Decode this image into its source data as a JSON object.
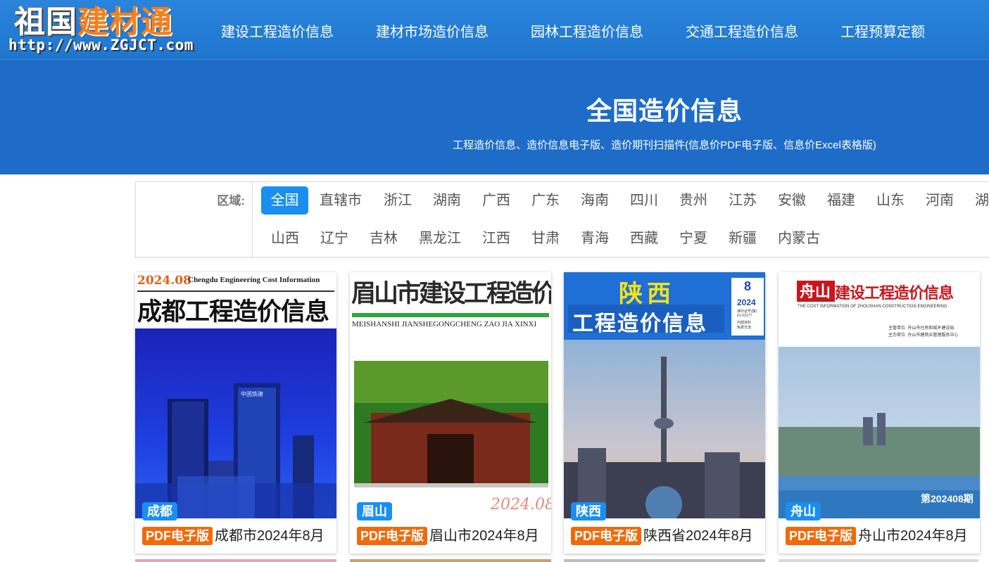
{
  "logo": {
    "name_part1": "祖国",
    "name_part2": "建材通",
    "url": "http://www.ZGJCT.com"
  },
  "nav": [
    {
      "label": "建设工程造价信息"
    },
    {
      "label": "建材市场造价信息"
    },
    {
      "label": "园林工程造价信息"
    },
    {
      "label": "交通工程造价信息"
    },
    {
      "label": "工程预算定额"
    }
  ],
  "banner": {
    "title": "全国造价信息",
    "subtitle": "工程造价信息、造价信息电子版、造价期刊扫描件(信息价PDF电子版、信息价Excel表格版)"
  },
  "filter": {
    "label": "区域:",
    "selected": "全国",
    "regions_row1": [
      "全国",
      "直辖市",
      "浙江",
      "湖南",
      "广西",
      "广东",
      "海南",
      "四川",
      "贵州",
      "江苏",
      "安徽",
      "福建",
      "山东",
      "河南",
      "湖"
    ],
    "regions_row2": [
      "山西",
      "辽宁",
      "吉林",
      "黑龙江",
      "江西",
      "甘肃",
      "青海",
      "西藏",
      "宁夏",
      "新疆",
      "内蒙古"
    ]
  },
  "cards": [
    {
      "tag": "成都",
      "badge": "PDF电子版",
      "title": "成都市2024年8月",
      "cover": {
        "issue": "2024.08",
        "english": "Chengdu Engineering Cost Information",
        "heading": "成都工程造价信息",
        "sign": "中国铁建"
      }
    },
    {
      "tag": "眉山",
      "badge": "PDF电子版",
      "title": "眉山市2024年8月",
      "cover": {
        "heading": "眉山市建设工程造价信息",
        "pinyin": "MEISHANSHI JIANSHEGONGCHENG ZAO JIA XINXI",
        "year": "2024.08"
      }
    },
    {
      "tag": "陕西",
      "badge": "PDF电子版",
      "title": "陕西省2024年8月",
      "cover": {
        "heading1": "陕西",
        "heading2": "工程造价信息",
        "issue_no": "8",
        "year": "2024",
        "note1": "准印证号(陕)",
        "note2": "61-03177",
        "note3": "内部资料",
        "note4": "免费交流"
      }
    },
    {
      "tag": "舟山",
      "badge": "PDF电子版",
      "title": "舟山市2024年8月",
      "cover": {
        "city": "舟山",
        "heading": "建设工程造价信息",
        "english": "THE COST INFORMATION OF ZHOUSHAN CONSTRUCTION ENGINEERING",
        "host_label": "主管单位",
        "host": "舟山市住房和城乡建设局",
        "org_label": "主办单位",
        "org": "舟山市建筑业管理服务中心",
        "issue_prefix": "第",
        "issue_year": "2024",
        "issue_no": "08",
        "issue_suffix": "期"
      }
    }
  ],
  "colors": {
    "header": "#2a84dc",
    "banner": "#1e6cc7",
    "accent": "#1a8fef",
    "badge": "#f06a0a"
  }
}
